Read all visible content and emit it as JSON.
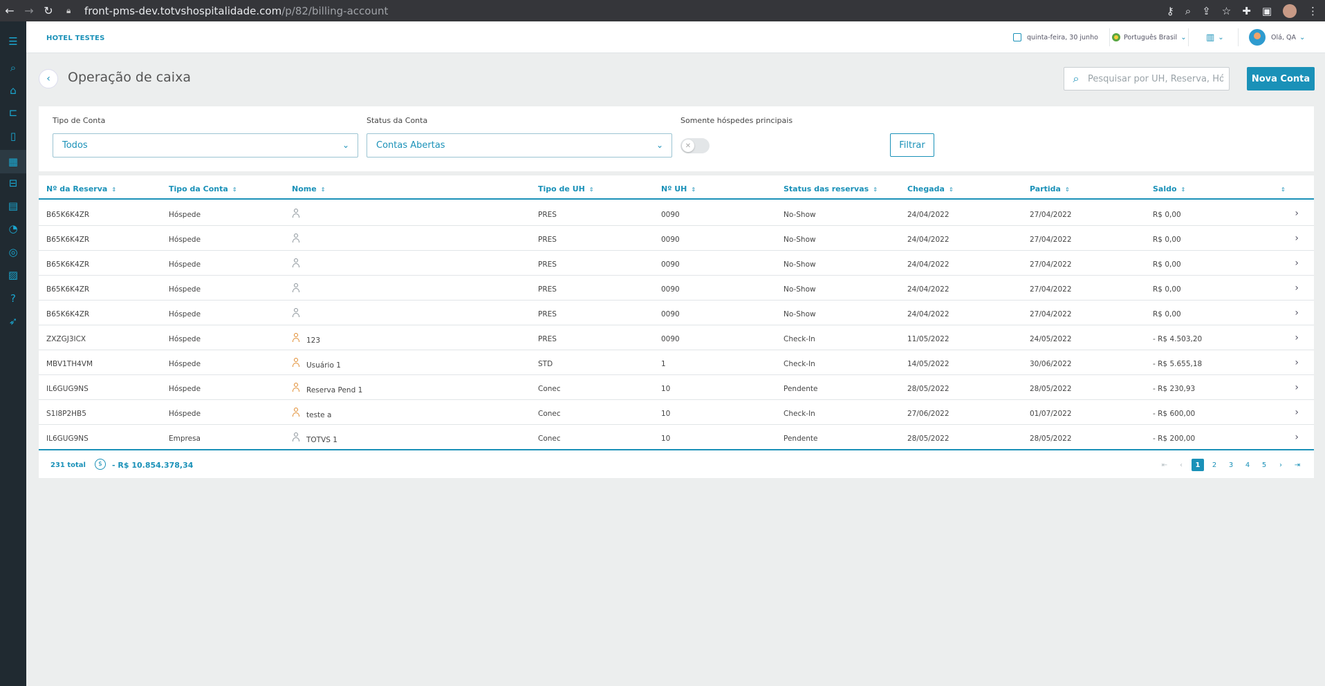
{
  "browser": {
    "url_host": "front-pms-dev.totvshospitalidade.com",
    "url_path": "/p/82/billing-account"
  },
  "header": {
    "hotel_name": "HOTEL TESTES",
    "date": "quinta-feira, 30 junho",
    "language": "Português Brasil",
    "greeting": "Olá, QA"
  },
  "page": {
    "title": "Operação de caixa",
    "search_placeholder": "Pesquisar por UH, Reserva, Hósp",
    "new_button": "Nova Conta"
  },
  "filters": {
    "account_type_label": "Tipo de Conta",
    "account_type_value": "Todos",
    "status_label": "Status da Conta",
    "status_value": "Contas Abertas",
    "main_guests_label": "Somente hóspedes principais",
    "main_guests_on": false,
    "filter_button": "Filtrar"
  },
  "table": {
    "columns": [
      "Nº da Reserva",
      "Tipo da Conta",
      "Nome",
      "Tipo de UH",
      "Nº UH",
      "Status das reservas",
      "Chegada",
      "Partida",
      "Saldo",
      ""
    ],
    "rows": [
      {
        "reserva": "B65K6K4ZR",
        "tipo": "Hóspede",
        "nome": "",
        "uh_tipo": "PRES",
        "uh": "0090",
        "status": "No-Show",
        "chegada": "24/04/2022",
        "partida": "27/04/2022",
        "saldo": "R$ 0,00",
        "warn": false
      },
      {
        "reserva": "B65K6K4ZR",
        "tipo": "Hóspede",
        "nome": "",
        "uh_tipo": "PRES",
        "uh": "0090",
        "status": "No-Show",
        "chegada": "24/04/2022",
        "partida": "27/04/2022",
        "saldo": "R$ 0,00",
        "warn": false
      },
      {
        "reserva": "B65K6K4ZR",
        "tipo": "Hóspede",
        "nome": "",
        "uh_tipo": "PRES",
        "uh": "0090",
        "status": "No-Show",
        "chegada": "24/04/2022",
        "partida": "27/04/2022",
        "saldo": "R$ 0,00",
        "warn": false
      },
      {
        "reserva": "B65K6K4ZR",
        "tipo": "Hóspede",
        "nome": "",
        "uh_tipo": "PRES",
        "uh": "0090",
        "status": "No-Show",
        "chegada": "24/04/2022",
        "partida": "27/04/2022",
        "saldo": "R$ 0,00",
        "warn": false
      },
      {
        "reserva": "B65K6K4ZR",
        "tipo": "Hóspede",
        "nome": "",
        "uh_tipo": "PRES",
        "uh": "0090",
        "status": "No-Show",
        "chegada": "24/04/2022",
        "partida": "27/04/2022",
        "saldo": "R$ 0,00",
        "warn": false
      },
      {
        "reserva": "ZXZGJ3ICX",
        "tipo": "Hóspede",
        "nome": "123",
        "uh_tipo": "PRES",
        "uh": "0090",
        "status": "Check-In",
        "chegada": "11/05/2022",
        "partida": "24/05/2022",
        "saldo": "- R$ 4.503,20",
        "warn": true
      },
      {
        "reserva": "MBV1TH4VM",
        "tipo": "Hóspede",
        "nome": "Usuário 1",
        "uh_tipo": "STD",
        "uh": "1",
        "status": "Check-In",
        "chegada": "14/05/2022",
        "partida": "30/06/2022",
        "saldo": "- R$ 5.655,18",
        "warn": true
      },
      {
        "reserva": "IL6GUG9NS",
        "tipo": "Hóspede",
        "nome": "Reserva Pend 1",
        "uh_tipo": "Conec",
        "uh": "10",
        "status": "Pendente",
        "chegada": "28/05/2022",
        "partida": "28/05/2022",
        "saldo": "- R$ 230,93",
        "warn": true
      },
      {
        "reserva": "S1I8P2HB5",
        "tipo": "Hóspede",
        "nome": "teste a",
        "uh_tipo": "Conec",
        "uh": "10",
        "status": "Check-In",
        "chegada": "27/06/2022",
        "partida": "01/07/2022",
        "saldo": "- R$ 600,00",
        "warn": true
      },
      {
        "reserva": "IL6GUG9NS",
        "tipo": "Empresa",
        "nome": "TOTVS 1",
        "uh_tipo": "Conec",
        "uh": "10",
        "status": "Pendente",
        "chegada": "28/05/2022",
        "partida": "28/05/2022",
        "saldo": "- R$ 200,00",
        "warn": false
      }
    ]
  },
  "footer": {
    "total": "231 total",
    "sum": "- R$ 10.854.378,34",
    "pages": [
      "1",
      "2",
      "3",
      "4",
      "5"
    ],
    "current_page": "1"
  },
  "colors": {
    "accent": "#1a91b8",
    "sidebar": "#202a31",
    "background": "#eceeee"
  }
}
